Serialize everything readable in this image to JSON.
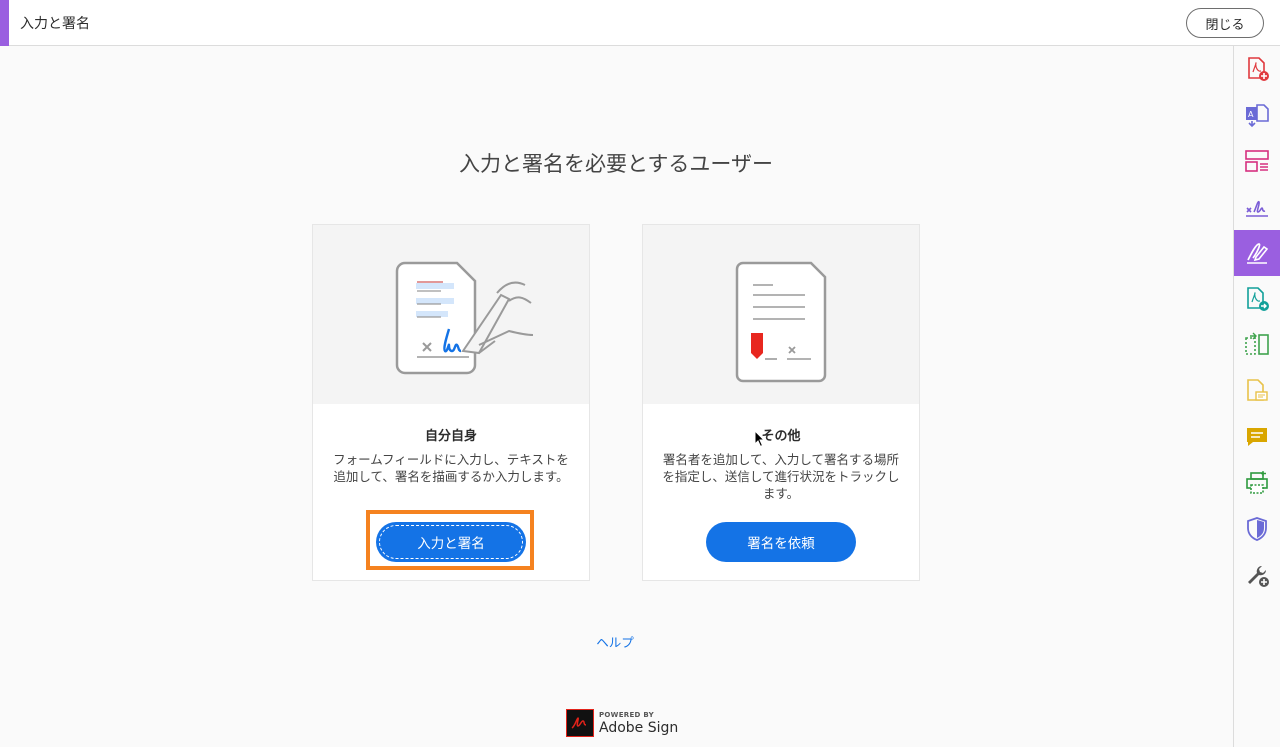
{
  "header": {
    "title": "入力と署名",
    "close_label": "閉じる"
  },
  "main": {
    "heading": "入力と署名を必要とするユーザー",
    "cards": [
      {
        "title": "自分自身",
        "description": "フォームフィールドに入力し、テキストを追加して、署名を描画するか入力します。",
        "button_label": "入力と署名"
      },
      {
        "title": "その他",
        "description": "署名者を追加して、入力して署名する場所を指定し、送信して進行状況をトラックします。",
        "button_label": "署名を依頼"
      }
    ],
    "help_link": "ヘルプ"
  },
  "footer": {
    "powered_by": "POWERED BY",
    "brand": "Adobe Sign"
  },
  "tool_rail": {
    "tools": [
      {
        "icon": "create-pdf-icon",
        "color": "#e0393e"
      },
      {
        "icon": "export-pdf-icon",
        "color": "#6b6bd6"
      },
      {
        "icon": "organize-pages-icon",
        "color": "#d6307f"
      },
      {
        "icon": "request-signature-icon",
        "color": "#7a5cd6"
      },
      {
        "icon": "fill-and-sign-icon",
        "color": "#9a5fe0",
        "active": true
      },
      {
        "icon": "send-for-review-icon",
        "color": "#12a09a"
      },
      {
        "icon": "compare-files-icon",
        "color": "#3fa34d"
      },
      {
        "icon": "add-comment-file-icon",
        "color": "#e8c24a"
      },
      {
        "icon": "comment-icon",
        "color": "#d9a600"
      },
      {
        "icon": "print-production-icon",
        "color": "#2e9a3e"
      },
      {
        "icon": "protect-icon",
        "color": "#6b6bd6"
      },
      {
        "icon": "more-tools-icon",
        "color": "#555555"
      }
    ]
  },
  "colors": {
    "accent_purple": "#9a5fe0",
    "button_blue": "#1473e6",
    "highlight_orange": "#f5821f"
  }
}
